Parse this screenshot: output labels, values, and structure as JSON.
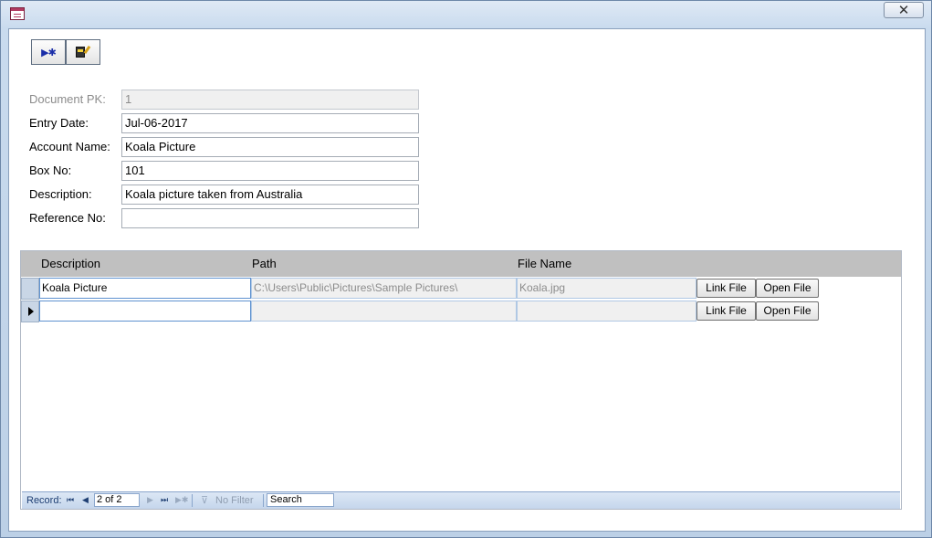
{
  "window": {
    "icon": "form-icon",
    "close_glyph": "✕"
  },
  "toolbar": {
    "new_record_glyph": "▶✱",
    "new_record_icon": "new-record-icon",
    "edit_icon": "edit-record-icon"
  },
  "form": {
    "document_pk": {
      "label": "Document PK:",
      "value": "1"
    },
    "entry_date": {
      "label": "Entry Date:",
      "value": "Jul-06-2017"
    },
    "account_name": {
      "label": "Account Name:",
      "value": "Koala Picture"
    },
    "box_no": {
      "label": "Box No:",
      "value": "101"
    },
    "description": {
      "label": "Description:",
      "value": "Koala picture taken from Australia"
    },
    "reference_no": {
      "label": "Reference No:",
      "value": ""
    }
  },
  "subform": {
    "columns": [
      "Description",
      "Path",
      "File Name"
    ],
    "rows": [
      {
        "description": "Koala Picture",
        "path": "C:\\Users\\Public\\Pictures\\Sample Pictures\\",
        "file_name": "Koala.jpg",
        "link_label": "Link File",
        "open_label": "Open File"
      },
      {
        "description": "",
        "path": "",
        "file_name": "",
        "link_label": "Link File",
        "open_label": "Open File"
      }
    ]
  },
  "navigation": {
    "record_label": "Record:",
    "first_glyph": "⏮",
    "prev_glyph": "◀",
    "current": "2 of 2",
    "next_glyph": "▶",
    "last_glyph": "⏭",
    "new_glyph": "▶✱",
    "filter_glyph": "⊽",
    "filter_label": "No Filter",
    "search_label": "Search"
  },
  "colors": {
    "header_bg": "#c0c0c0",
    "nav_text": "#1f3f73",
    "locked_bg": "#f0f0f0"
  }
}
